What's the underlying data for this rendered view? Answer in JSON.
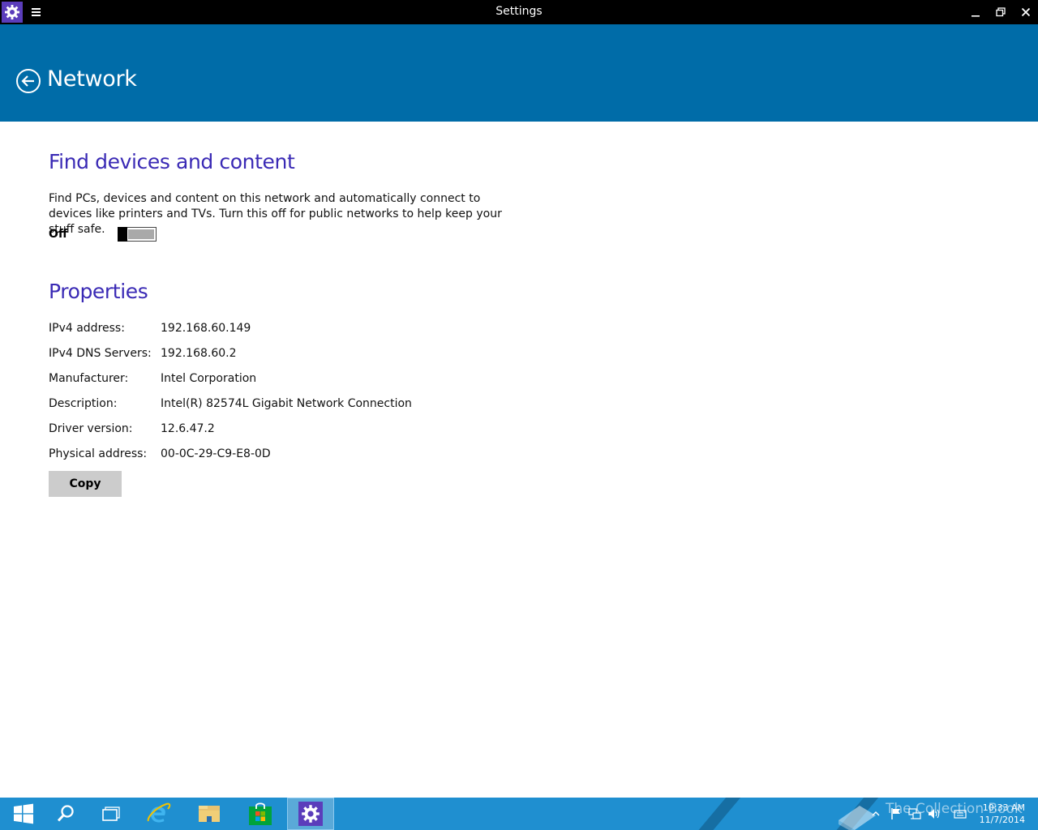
{
  "window": {
    "title": "Settings",
    "app_icon": "gear-icon",
    "menu_icon": "hamburger-icon",
    "controls": [
      "minimize-icon",
      "restore-icon",
      "close-icon"
    ]
  },
  "header": {
    "title": "Network",
    "back_icon": "back-arrow-icon",
    "background_color": "#006ca8"
  },
  "find_devices": {
    "heading": "Find devices and content",
    "description": "Find PCs, devices and content on this network and automatically connect to devices like printers and TVs. Turn this off for public networks to help keep your stuff safe.",
    "toggle_label": "Off",
    "toggle_on": false
  },
  "properties": {
    "heading": "Properties",
    "rows": [
      {
        "label": "IPv4 address:",
        "value": "192.168.60.149"
      },
      {
        "label": "IPv4 DNS Servers:",
        "value": "192.168.60.2"
      },
      {
        "label": "Manufacturer:",
        "value": "Intel Corporation"
      },
      {
        "label": "Description:",
        "value": "Intel(R) 82574L Gigabit Network Connection"
      },
      {
        "label": "Driver version:",
        "value": "12.6.47.2"
      },
      {
        "label": "Physical address:",
        "value": "00-0C-29-C9-E8-0D"
      }
    ],
    "copy_label": "Copy"
  },
  "taskbar": {
    "buttons": [
      "start-icon",
      "search-icon",
      "task-view-icon",
      "internet-explorer-icon",
      "file-explorer-icon",
      "store-icon",
      "settings-icon"
    ],
    "active": "settings-icon",
    "tray_icons": [
      "show-hidden-icons-icon",
      "action-center-flag-icon",
      "network-icon",
      "volume-icon",
      "keyboard-icon"
    ],
    "time": "10:33 AM",
    "date": "11/7/2014",
    "watermark": "The Collection Book",
    "color": "#1f8fd0"
  },
  "colors": {
    "section_heading": "#3a2ab5",
    "settings_icon_bg": "#5b3dbb"
  }
}
